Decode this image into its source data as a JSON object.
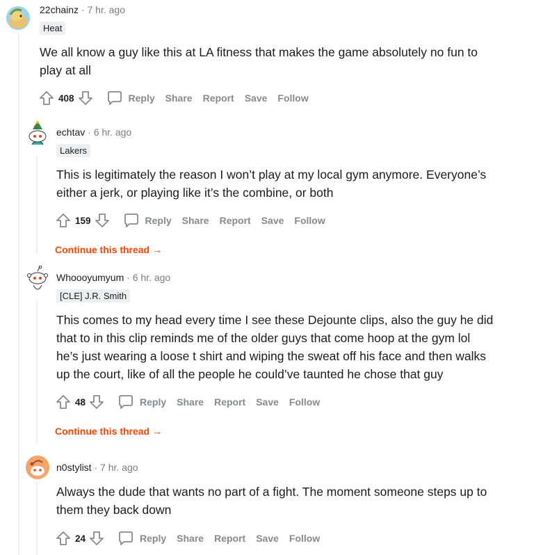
{
  "actions": {
    "reply": "Reply",
    "share": "Share",
    "report": "Report",
    "save": "Save",
    "follow": "Follow"
  },
  "comments": [
    {
      "username": "22chainz",
      "separator": "·",
      "time": "7 hr. ago",
      "flair": "Heat",
      "body": [
        "We all know a guy like this at LA fitness that makes the game absolutely no fun to",
        "play at all"
      ],
      "score": "408"
    },
    {
      "username": "echtav",
      "separator": "·",
      "time": "6 hr. ago",
      "flair": "Lakers",
      "body": [
        "This is legitimately the reason I won’t play at my local gym anymore. Everyone’s",
        "either a jerk, or playing like it’s the combine, or both"
      ],
      "score": "159",
      "continue_label": "Continue this thread →"
    },
    {
      "username": "Whoooyumyum",
      "separator": "·",
      "time": "6 hr. ago",
      "flair": "[CLE] J.R. Smith",
      "body": [
        "This comes to my head every time I see these Dejounte clips, also the guy he did",
        "that to in this clip reminds me of the older guys that come hoop at the gym lol",
        "he’s just wearing a loose t shirt and wiping the sweat off his face and then walks",
        "up the court, like of all the people he could’ve taunted he chose that guy"
      ],
      "score": "48",
      "continue_label": "Continue this thread →"
    },
    {
      "username": "n0stylist",
      "separator": "·",
      "time": "7 hr. ago",
      "body": [
        "Always the dude that wants no part of a fight. The moment someone steps up to",
        "them they back down"
      ],
      "score": "24"
    }
  ]
}
